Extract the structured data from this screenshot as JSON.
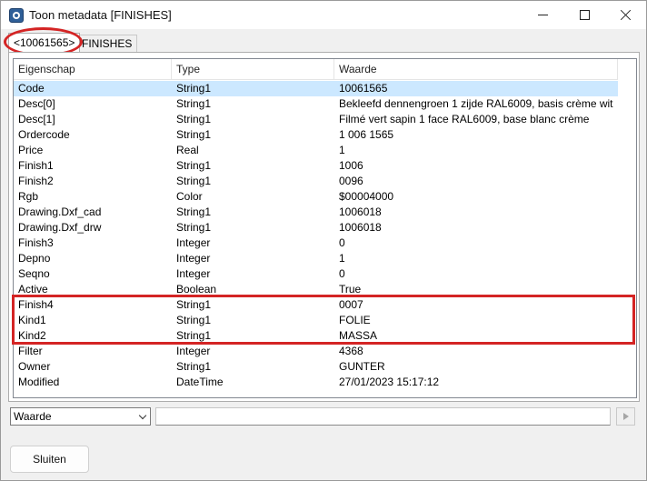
{
  "window": {
    "title": "Toon metadata [FINISHES]",
    "icon": "app-icon"
  },
  "tabs": [
    {
      "label": "<10061565>",
      "active": true
    },
    {
      "label": "FINISHES",
      "active": false
    }
  ],
  "table": {
    "columns": [
      "Eigenschap",
      "Type",
      "Waarde"
    ],
    "rows": [
      {
        "name": "Code",
        "type": "String1",
        "value": "10061565"
      },
      {
        "name": "Desc[0]",
        "type": "String1",
        "value": "Bekleefd dennengroen 1 zijde RAL6009, basis crème wit"
      },
      {
        "name": "Desc[1]",
        "type": "String1",
        "value": "Filmé vert sapin 1 face RAL6009, base blanc crème"
      },
      {
        "name": "Ordercode",
        "type": "String1",
        "value": "1 006 1565"
      },
      {
        "name": "Price",
        "type": "Real",
        "value": "1"
      },
      {
        "name": "Finish1",
        "type": "String1",
        "value": "1006"
      },
      {
        "name": "Finish2",
        "type": "String1",
        "value": "0096"
      },
      {
        "name": "Rgb",
        "type": "Color",
        "value": "$00004000"
      },
      {
        "name": "Drawing.Dxf_cad",
        "type": "String1",
        "value": "1006018"
      },
      {
        "name": "Drawing.Dxf_drw",
        "type": "String1",
        "value": "1006018"
      },
      {
        "name": "Finish3",
        "type": "Integer",
        "value": "0"
      },
      {
        "name": "Depno",
        "type": "Integer",
        "value": "1"
      },
      {
        "name": "Seqno",
        "type": "Integer",
        "value": "0"
      },
      {
        "name": "Active",
        "type": "Boolean",
        "value": "True"
      },
      {
        "name": "Finish4",
        "type": "String1",
        "value": "0007"
      },
      {
        "name": "Kind1",
        "type": "String1",
        "value": "FOLIE"
      },
      {
        "name": "Kind2",
        "type": "String1",
        "value": "MASSA"
      },
      {
        "name": "Filter",
        "type": "Integer",
        "value": "4368"
      },
      {
        "name": "Owner",
        "type": "String1",
        "value": "GUNTER"
      },
      {
        "name": "Modified",
        "type": "DateTime",
        "value": "27/01/2023 15:17:12"
      }
    ],
    "selected_index": 0
  },
  "filter": {
    "selected": "Waarde",
    "input_value": ""
  },
  "footer": {
    "close_label": "Sluiten"
  },
  "colors": {
    "selection": "#cce8ff",
    "annotation": "#d42424"
  }
}
